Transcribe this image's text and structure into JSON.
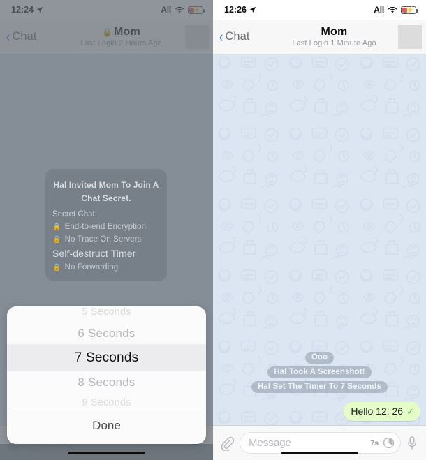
{
  "left": {
    "status": {
      "time": "12:24",
      "location_icon": "location-arrow-icon",
      "carrier": "All",
      "wifi_icon": "wifi-icon",
      "battery_icon": "battery-charging-icon"
    },
    "nav": {
      "back_label": "Chat",
      "back_icon": "chevron-left-icon",
      "lock_icon": "lock-icon",
      "title": "Mom",
      "subtitle": "Last Login 2 Hours Ago",
      "avatar": "avatar"
    },
    "secret_card": {
      "title": "Hal Invited Mom To Join A Chat Secret.",
      "section_label": "Secret Chat:",
      "features": [
        {
          "icon": "lock-icon",
          "label": "End-to-end Encryption",
          "emphasis": false
        },
        {
          "icon": "lock-icon",
          "label": "No Trace On Servers",
          "emphasis": false
        },
        {
          "icon": "",
          "label": "Self-destruct Timer",
          "emphasis": true
        },
        {
          "icon": "lock-icon",
          "label": "No Forwarding",
          "emphasis": false
        }
      ]
    },
    "picker": {
      "options": [
        "5 Seconds",
        "6 Seconds",
        "7 Seconds",
        "8 Seconds",
        "9 Seconds"
      ],
      "selected": "7 Seconds",
      "done_label": "Done"
    }
  },
  "right": {
    "status": {
      "time": "12:26",
      "location_icon": "location-arrow-icon",
      "carrier": "All",
      "wifi_icon": "wifi-icon",
      "battery_icon": "battery-charging-icon"
    },
    "nav": {
      "back_label": "Chat",
      "back_icon": "chevron-left-icon",
      "lock_icon": "",
      "title": "Mom",
      "subtitle": "Last Login 1 Minute Ago",
      "avatar": "avatar"
    },
    "messages": [
      {
        "type": "service",
        "text": "Ooo"
      },
      {
        "type": "service",
        "text": "Hal Took A Screenshot!"
      },
      {
        "type": "service",
        "text": "Hal Set The Timer To 7 Seconds"
      }
    ],
    "outgoing": {
      "text": "Hello 12: 26",
      "status_icon": "single-check-icon"
    },
    "input": {
      "attach_icon": "paperclip-icon",
      "placeholder": "Message",
      "timer_label": "7s",
      "timer_icon": "self-destruct-timer-icon",
      "mic_icon": "microphone-icon"
    }
  },
  "colors": {
    "wallpaper": "#dce6f2",
    "outgoing_bubble": "#e4fdc8",
    "accent_blue": "#2f7ed8",
    "service_bubble": "rgba(125,140,155,.46)"
  }
}
